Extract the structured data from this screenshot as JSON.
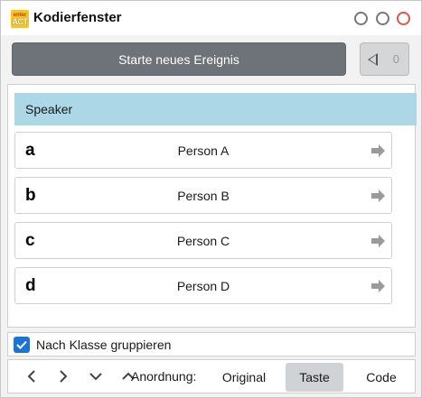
{
  "window": {
    "title": "Kodierfenster",
    "icon_lines": [
      "enter",
      "ACT"
    ]
  },
  "toolbar_top": {
    "start_label": "Starte neues Ereignis",
    "undo_count": "0"
  },
  "group": {
    "header": "Speaker",
    "items": [
      {
        "key": "a",
        "label": "Person A"
      },
      {
        "key": "b",
        "label": "Person B"
      },
      {
        "key": "c",
        "label": "Person C"
      },
      {
        "key": "d",
        "label": "Person D"
      }
    ]
  },
  "options": {
    "group_by_class_label": "Nach Klasse gruppieren",
    "group_by_class_checked": true
  },
  "bottom": {
    "sort_label": "Anordnung:",
    "sort_options": [
      "Original",
      "Taste",
      "Code"
    ],
    "active_sort": "Taste"
  },
  "colors": {
    "header_bg": "#acd7e6",
    "start_button_bg": "#6d7378",
    "checkbox": "#1a73d9",
    "close_btn": "#e0544a"
  },
  "icons": [
    "app-logo-icon",
    "minimize-icon",
    "maximize-icon",
    "close-icon",
    "undo-triangle-icon",
    "arrow-right-icon",
    "chevron-left-icon",
    "chevron-right-icon",
    "chevron-down-icon",
    "chevron-up-icon",
    "checkmark-icon"
  ]
}
